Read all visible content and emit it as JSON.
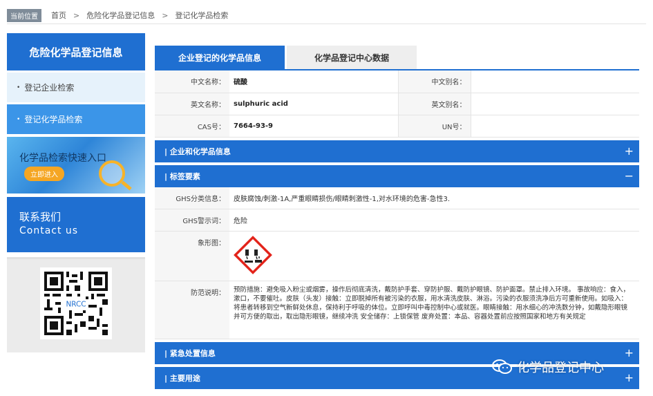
{
  "breadcrumb": {
    "tag": "当前位置",
    "items": [
      "首页",
      "危险化学品登记信息",
      "登记化学品检索"
    ],
    "separator": ">"
  },
  "sidebar": {
    "title": "危险化学品登记信息",
    "items": [
      {
        "label": "登记企业检索",
        "active": false
      },
      {
        "label": "登记化学品检索",
        "active": true
      }
    ],
    "banner": {
      "text": "化学品检索快速入口",
      "button": "立即进入"
    },
    "contact": {
      "line1": "联系我们",
      "line2": "Contact us"
    }
  },
  "tabs": [
    {
      "label": "企业登记的化学品信息",
      "active": true
    },
    {
      "label": "化学品登记中心数据",
      "active": false
    }
  ],
  "info": {
    "cn_name_label": "中文名称：",
    "cn_name": "硫酸",
    "cn_alias_label": "中文别名：",
    "cn_alias": "",
    "en_name_label": "英文名称：",
    "en_name": "sulphuric acid",
    "en_alias_label": "英文别名：",
    "en_alias": "",
    "cas_label": "CAS号：",
    "cas": "7664-93-9",
    "un_label": "UN号：",
    "un": ""
  },
  "sections": {
    "company": {
      "label": "| 企业和化学品信息",
      "toggle": "+"
    },
    "label_elements": {
      "label": "| 标签要素",
      "toggle": "−"
    },
    "emergency": {
      "label": "| 紧急处置信息",
      "toggle": "+"
    },
    "usage": {
      "label": "| 主要用途",
      "toggle": "+"
    }
  },
  "label_elements": {
    "ghs_class_label": "GHS分类信息：",
    "ghs_class": "皮肤腐蚀/刺激-1A,严重眼睛损伤/眼睛刺激性-1,对水环境的危害-急性3.",
    "signal_label": "GHS警示词：",
    "signal": "危险",
    "pictogram_label": "象形图：",
    "pictogram_icon": "corrosion-pictogram",
    "precaution_label": "防范说明：",
    "precaution": "预防措施：避免吸入粉尘或烟雾，操作后彻底清洗，戴防护手套、穿防护服、戴防护眼镜、防护面罩。禁止排入环境。 事故响应：食入，漱口，不要催吐。皮肤（头发）接触：立即脱掉所有被污染的衣服，用水清洗皮肤、淋浴。污染的衣服须洗净后方可重新使用。如吸入：将患者转移到空气新鲜处休息，保持利于呼吸的体位。立即呼叫中毒控制中心或就医。眼睛接触：用水细心的冲洗数分钟，如戴隐形眼镜并可方便的取出，取出隐形眼镜，继续冲洗 安全储存：上锁保管 废弃处置：本品、容器处置前应按照国家和地方有关规定"
  },
  "watermark": {
    "text": "化学品登记中心",
    "icon": "wechat-icon"
  },
  "colors": {
    "primary": "#1f6fd1",
    "light": "#3b95e8",
    "pictogram_border": "#e3241b"
  }
}
